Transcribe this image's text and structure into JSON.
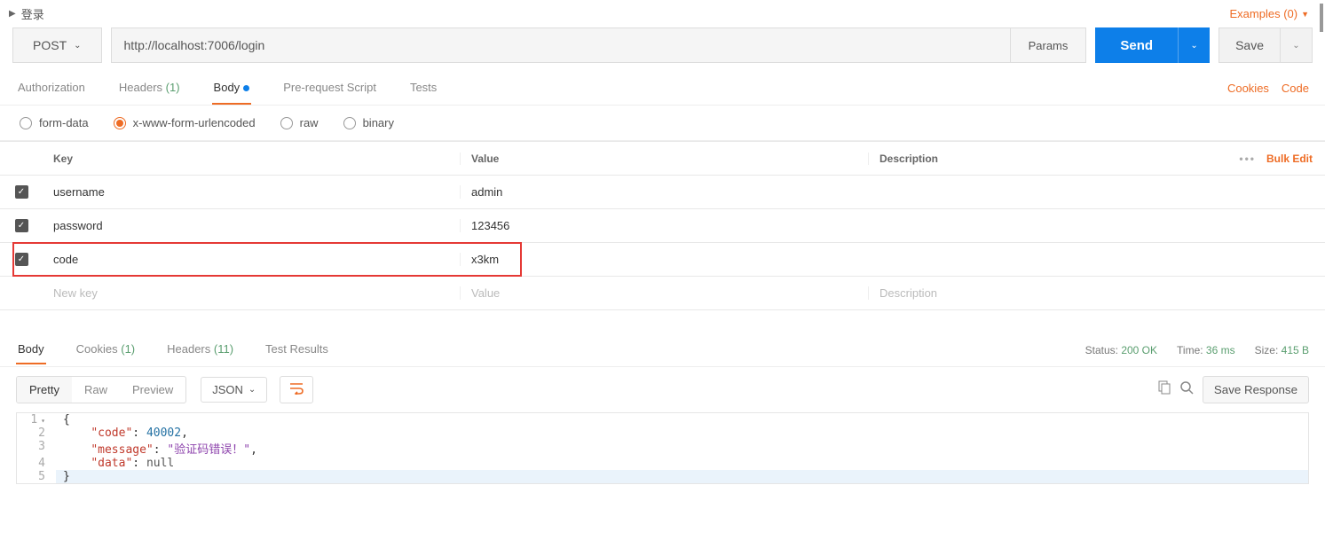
{
  "header": {
    "title": "登录",
    "examples_label": "Examples (0)"
  },
  "request": {
    "method": "POST",
    "url": "http://localhost:7006/login",
    "params_btn": "Params",
    "send_btn": "Send",
    "save_btn": "Save"
  },
  "req_tabs": {
    "authorization": "Authorization",
    "headers": "Headers",
    "headers_count": "(1)",
    "body": "Body",
    "prerequest": "Pre-request Script",
    "tests": "Tests",
    "cookies": "Cookies",
    "code": "Code"
  },
  "body_types": {
    "form_data": "form-data",
    "urlencoded": "x-www-form-urlencoded",
    "raw": "raw",
    "binary": "binary"
  },
  "ptable": {
    "hdr_key": "Key",
    "hdr_val": "Value",
    "hdr_desc": "Description",
    "bulk": "Bulk Edit",
    "ph_key": "New key",
    "ph_val": "Value",
    "ph_desc": "Description",
    "rows": [
      {
        "key": "username",
        "value": "admin",
        "desc": ""
      },
      {
        "key": "password",
        "value": "123456",
        "desc": ""
      },
      {
        "key": "code",
        "value": "x3km",
        "desc": ""
      }
    ]
  },
  "resp_tabs": {
    "body": "Body",
    "cookies": "Cookies",
    "cookies_cnt": "(1)",
    "headers": "Headers",
    "headers_cnt": "(11)",
    "test_results": "Test Results"
  },
  "resp_status": {
    "status_lbl": "Status:",
    "status_val": "200 OK",
    "time_lbl": "Time:",
    "time_val": "36 ms",
    "size_lbl": "Size:",
    "size_val": "415 B"
  },
  "resp_tools": {
    "pretty": "Pretty",
    "raw": "Raw",
    "preview": "Preview",
    "format": "JSON",
    "save_resp": "Save Response"
  },
  "response_body": {
    "code": 40002,
    "message": "验证码错误！",
    "data": null
  },
  "editor_lines": {
    "l1": "1",
    "l2": "2",
    "l3": "3",
    "l4": "4",
    "l5": "5"
  }
}
